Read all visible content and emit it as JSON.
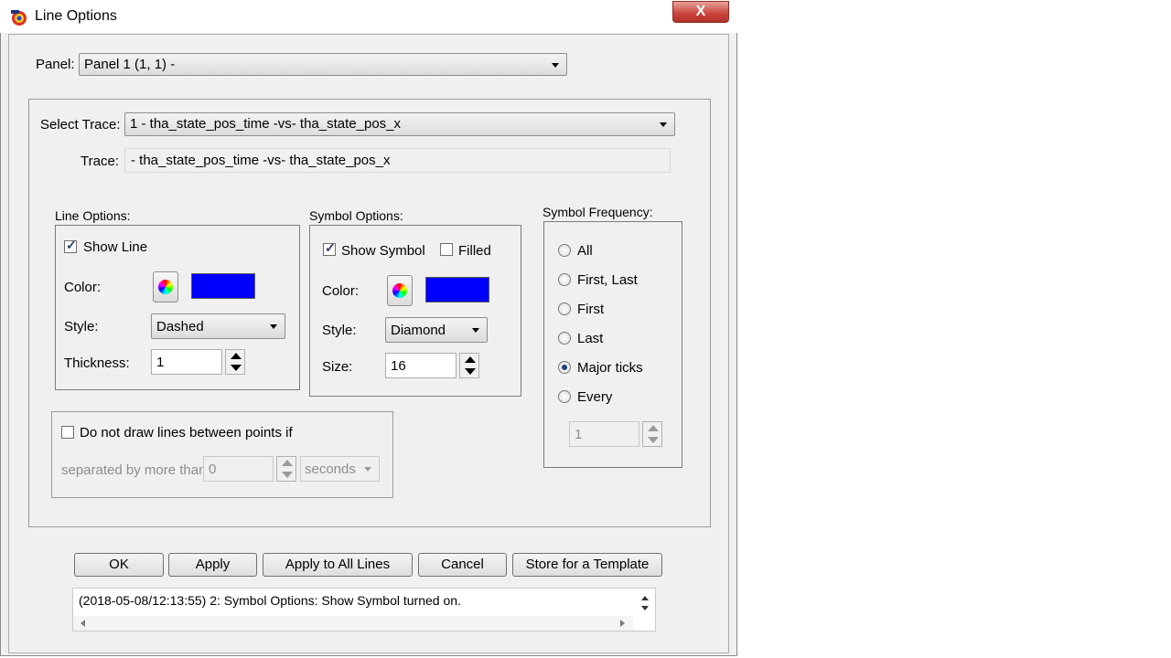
{
  "window": {
    "title": "Line Options",
    "close_label": "X"
  },
  "panel": {
    "label": "Panel:",
    "value": "Panel 1 (1, 1)  -"
  },
  "select_trace": {
    "label": "Select Trace:",
    "value": "1  - tha_state_pos_time -vs- tha_state_pos_x"
  },
  "trace": {
    "label": "Trace:",
    "value": " - tha_state_pos_time -vs- tha_state_pos_x"
  },
  "line_options": {
    "title": "Line Options:",
    "show_line_label": "Show Line",
    "show_line_checked": true,
    "color_label": "Color:",
    "color": "#0000ff",
    "style_label": "Style:",
    "style_value": "Dashed",
    "thickness_label": "Thickness:",
    "thickness_value": "1"
  },
  "symbol_options": {
    "title": "Symbol Options:",
    "show_symbol_label": "Show Symbol",
    "show_symbol_checked": true,
    "filled_label": "Filled",
    "filled_checked": false,
    "color_label": "Color:",
    "color": "#0000ff",
    "style_label": "Style:",
    "style_value": "Diamond",
    "size_label": "Size:",
    "size_value": "16"
  },
  "symbol_frequency": {
    "title": "Symbol Frequency:",
    "options": [
      "All",
      "First, Last",
      "First",
      "Last",
      "Major ticks",
      "Every"
    ],
    "selected": "Major ticks",
    "every_value": "1"
  },
  "gap": {
    "checkbox_label": "Do not draw lines between points if",
    "checked": false,
    "separated_label": "separated by more than",
    "value": "0",
    "unit": "seconds"
  },
  "buttons": {
    "ok": "OK",
    "apply": "Apply",
    "apply_all": "Apply to All Lines",
    "cancel": "Cancel",
    "store_template": "Store for a Template"
  },
  "log": {
    "text": "(2018-05-08/12:13:55) 2: Symbol Options: Show Symbol turned on."
  },
  "icons": {
    "app": "app-icon",
    "color_picker": "color-wheel-icon"
  }
}
